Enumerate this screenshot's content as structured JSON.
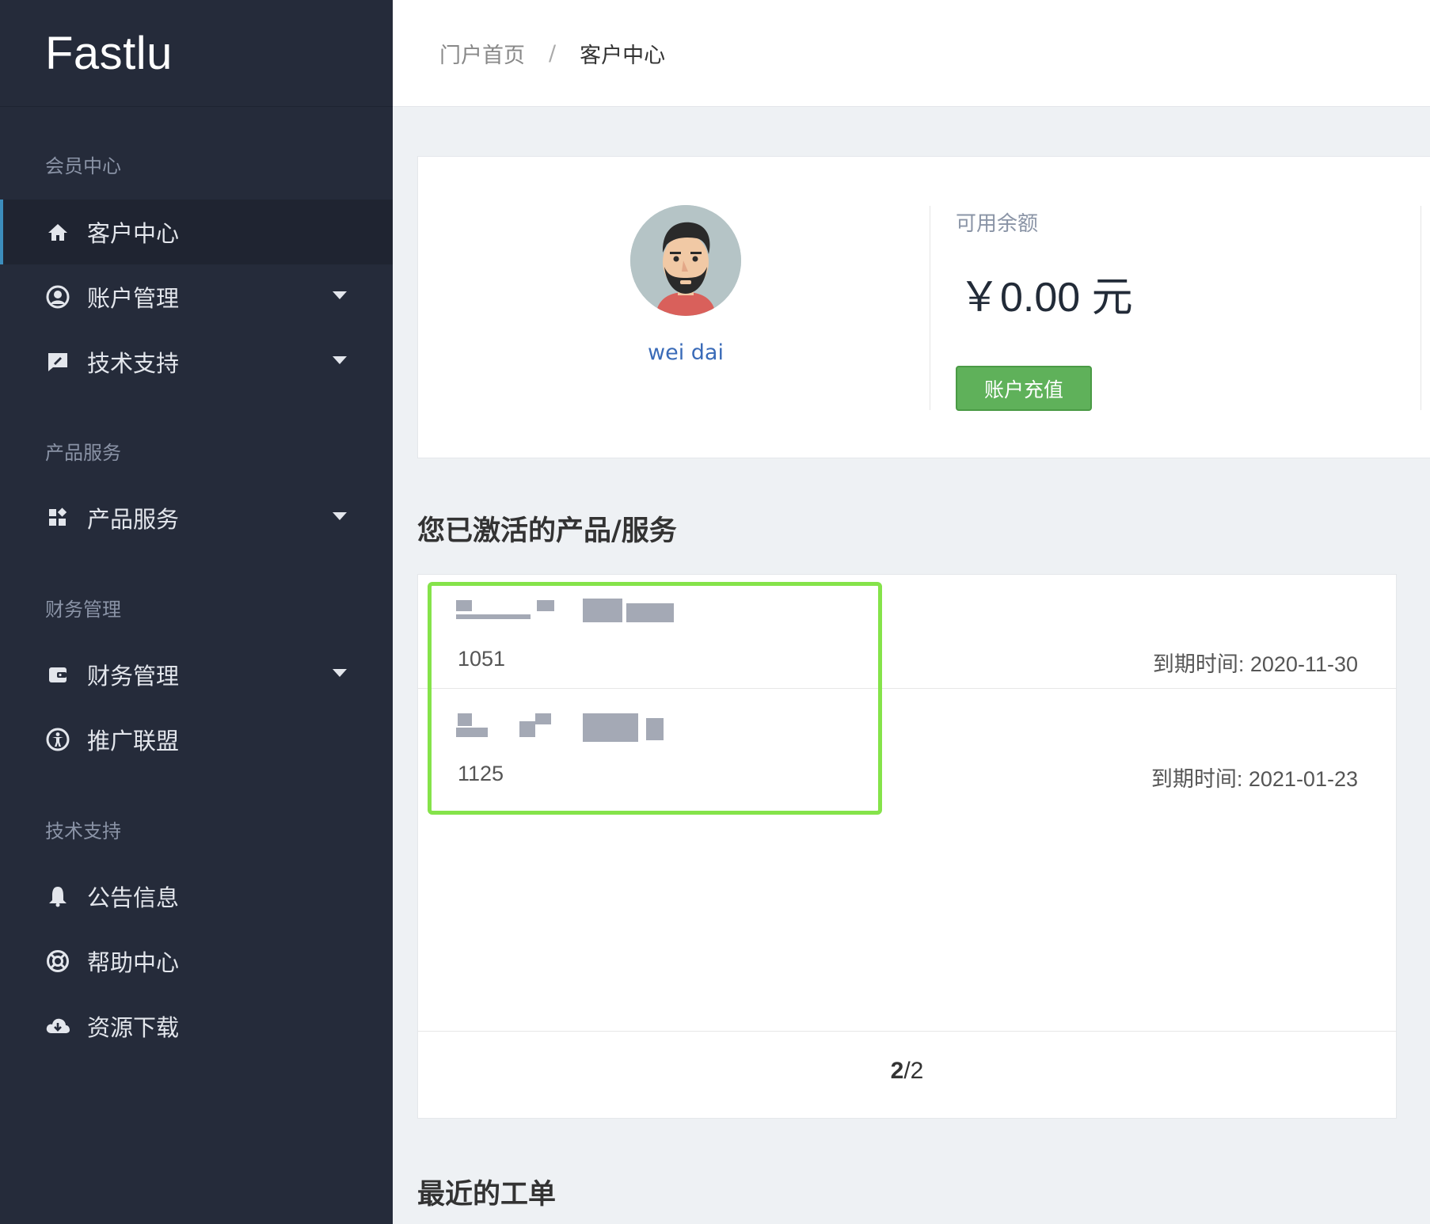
{
  "brand": {
    "name": "Fastlu"
  },
  "sidebar": {
    "sections": [
      {
        "title": "会员中心"
      },
      {
        "title": "产品服务"
      },
      {
        "title": "财务管理"
      },
      {
        "title": "技术支持"
      }
    ],
    "items": [
      {
        "label": "客户中心",
        "icon": "home-icon",
        "active": true
      },
      {
        "label": "账户管理",
        "icon": "user-circle-icon",
        "caret": true
      },
      {
        "label": "技术支持",
        "icon": "edit-chat-icon",
        "caret": true
      },
      {
        "label": "产品服务",
        "icon": "widgets-icon",
        "caret": true
      },
      {
        "label": "财务管理",
        "icon": "wallet-icon",
        "caret": true
      },
      {
        "label": "推广联盟",
        "icon": "accessibility-icon"
      },
      {
        "label": "公告信息",
        "icon": "bell-icon"
      },
      {
        "label": "帮助中心",
        "icon": "lifebuoy-icon"
      },
      {
        "label": "资源下载",
        "icon": "cloud-download-icon"
      }
    ]
  },
  "breadcrumb": {
    "home": "门户首页",
    "separator": "/",
    "current": "客户中心"
  },
  "profile": {
    "username": "wei dai",
    "balance_label": "可用余额",
    "balance_value": "￥0.00 元",
    "recharge_label": "账户充值"
  },
  "products": {
    "title": "您已激活的产品/服务",
    "items": [
      {
        "id": "1051",
        "expire": "到期时间: 2020-11-30"
      },
      {
        "id": "1125",
        "expire": "到期时间: 2021-01-23"
      }
    ],
    "pager": {
      "current": "2",
      "total": "/2"
    }
  },
  "tickets": {
    "title": "最近的工单"
  },
  "colors": {
    "sidebar": "#252b3a",
    "accent": "#3c8dbc",
    "success": "#5fb15a",
    "highlight": "#85e34a"
  }
}
